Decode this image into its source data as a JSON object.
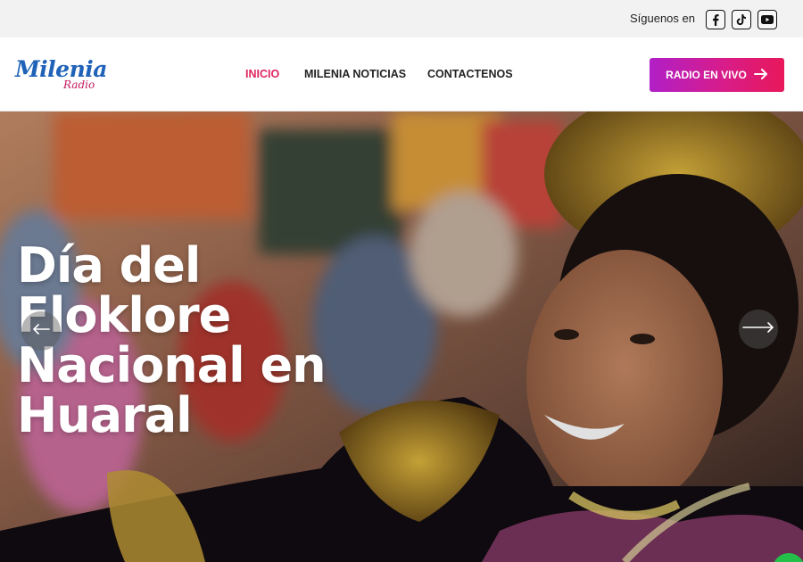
{
  "topbar": {
    "follow_label": "Síguenos en",
    "social": [
      "facebook-icon",
      "tiktok-icon",
      "youtube-icon"
    ]
  },
  "header": {
    "logo": {
      "name": "Milenia",
      "sub": "Radio"
    },
    "nav": [
      "INICIO",
      "MILENIA NOTICIAS",
      "CONTACTENOS"
    ],
    "active_nav": "INICIO",
    "cta_label": "RADIO EN VIVO"
  },
  "hero": {
    "title_lines": [
      "Día del Floklore",
      "Nacional en",
      "Huaral"
    ]
  },
  "colors": {
    "accent": "#e0245e",
    "brand_blue": "#1f62b8",
    "cta_gradient_start": "#b01fc7",
    "cta_gradient_end": "#e8185a"
  }
}
